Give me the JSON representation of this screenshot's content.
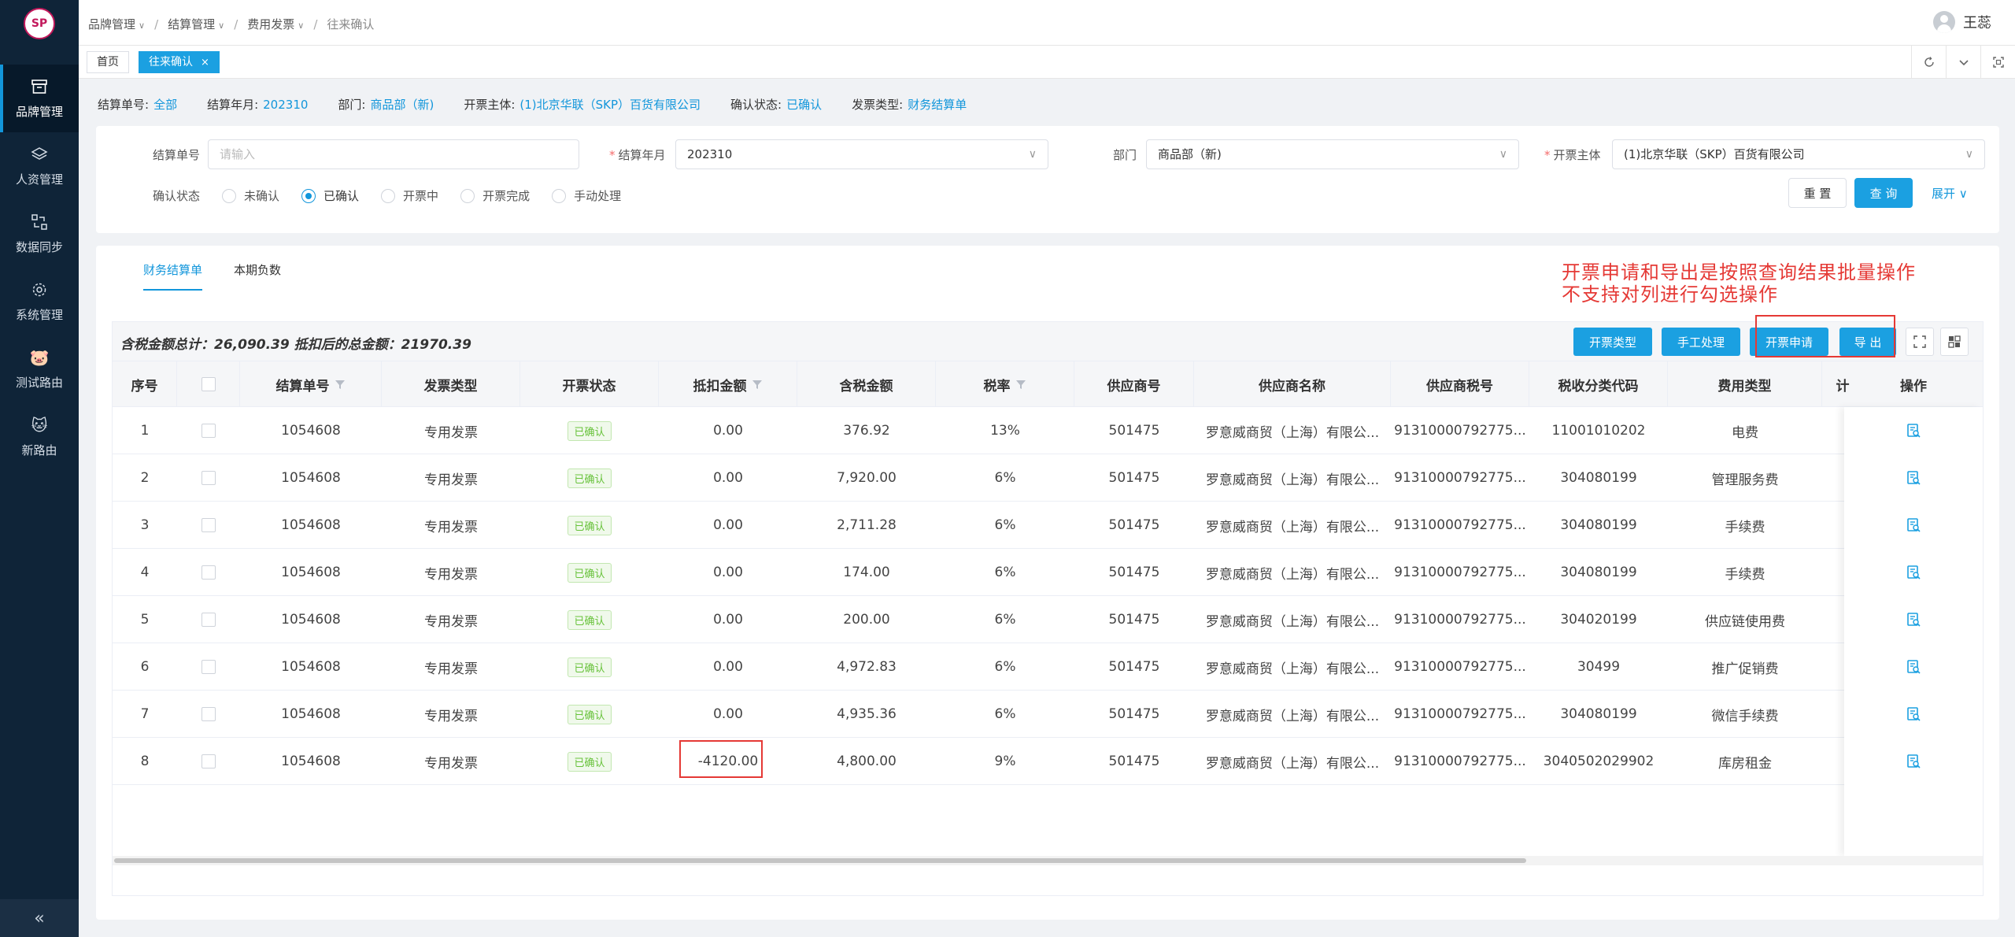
{
  "sidebar": {
    "logo_text": "SP",
    "items": [
      {
        "label": "品牌管理",
        "icon": "archive-box-icon",
        "active": true
      },
      {
        "label": "人资管理",
        "icon": "layers-icon",
        "active": false
      },
      {
        "label": "数据同步",
        "icon": "sync-icon",
        "active": false
      },
      {
        "label": "系统管理",
        "icon": "gear-icon",
        "active": false
      },
      {
        "label": "测试路由",
        "icon": "pig-face-icon",
        "active": false
      },
      {
        "label": "新路由",
        "icon": "cat-face-icon",
        "active": false
      }
    ],
    "collapse_symbol": "«"
  },
  "breadcrumb": {
    "items": [
      "品牌管理",
      "结算管理",
      "费用发票",
      "往来确认"
    ]
  },
  "user": {
    "name": "王蕊"
  },
  "tabs": [
    {
      "label": "首页",
      "active": false
    },
    {
      "label": "往来确认",
      "active": true,
      "close": "×"
    }
  ],
  "info": {
    "settle_no_label": "结算单号:",
    "settle_no_value": "全部",
    "settle_month_label": "结算年月:",
    "settle_month_value": "202310",
    "dept_label": "部门:",
    "dept_value": "商品部（新)",
    "entity_label": "开票主体:",
    "entity_value": "(1)北京华联（SKP）百货有限公司",
    "confirm_label": "确认状态:",
    "confirm_value": "已确认",
    "invoice_type_label": "发票类型:",
    "invoice_type_value": "财务结算单"
  },
  "filter": {
    "settle_no_label": "结算单号",
    "settle_no_placeholder": "请输入",
    "req_mark": "*",
    "settle_month_label": "结算年月",
    "settle_month_value": "202310",
    "dept_label": "部门",
    "dept_value": "商品部（新)",
    "entity_label": "开票主体",
    "entity_value": "(1)北京华联（SKP）百货有限公司",
    "status_label": "确认状态",
    "statuses": [
      {
        "label": "未确认",
        "checked": false
      },
      {
        "label": "已确认",
        "checked": true
      },
      {
        "label": "开票中",
        "checked": false
      },
      {
        "label": "开票完成",
        "checked": false
      },
      {
        "label": "手动处理",
        "checked": false
      }
    ],
    "reset_label": "重 置",
    "query_label": "查 询",
    "expand_label": "展开"
  },
  "subtabs": [
    {
      "label": "财务结算单",
      "active": true
    },
    {
      "label": "本期负数",
      "active": false
    }
  ],
  "annotation": {
    "line1": "开票申请和导出是按照查询结果批量操作",
    "line2": "不支持对列进行勾选操作"
  },
  "summary": {
    "text": "含税金额总计：26,090.39  抵扣后的总金额：21970.39"
  },
  "toolbar": {
    "invoice_type_btn": "开票类型",
    "manual_btn": "手工处理",
    "apply_btn": "开票申请",
    "export_btn": "导 出"
  },
  "table": {
    "columns": [
      "序号",
      "",
      "结算单号",
      "发票类型",
      "开票状态",
      "抵扣金额",
      "含税金额",
      "税率",
      "供应商号",
      "供应商名称",
      "供应商税号",
      "税收分类代码",
      "费用类型",
      "计",
      "操作"
    ],
    "rows": [
      [
        "1",
        "1054608",
        "专用发票",
        "已确认",
        "0.00",
        "376.92",
        "13%",
        "501475",
        "罗意威商贸（上海）有限公...",
        "91310000792775...",
        "11001010202",
        "电费"
      ],
      [
        "2",
        "1054608",
        "专用发票",
        "已确认",
        "0.00",
        "7,920.00",
        "6%",
        "501475",
        "罗意威商贸（上海）有限公...",
        "91310000792775...",
        "304080199",
        "管理服务费"
      ],
      [
        "3",
        "1054608",
        "专用发票",
        "已确认",
        "0.00",
        "2,711.28",
        "6%",
        "501475",
        "罗意威商贸（上海）有限公...",
        "91310000792775...",
        "304080199",
        "手续费"
      ],
      [
        "4",
        "1054608",
        "专用发票",
        "已确认",
        "0.00",
        "174.00",
        "6%",
        "501475",
        "罗意威商贸（上海）有限公...",
        "91310000792775...",
        "304080199",
        "手续费"
      ],
      [
        "5",
        "1054608",
        "专用发票",
        "已确认",
        "0.00",
        "200.00",
        "6%",
        "501475",
        "罗意威商贸（上海）有限公...",
        "91310000792775...",
        "304020199",
        "供应链使用费"
      ],
      [
        "6",
        "1054608",
        "专用发票",
        "已确认",
        "0.00",
        "4,972.83",
        "6%",
        "501475",
        "罗意威商贸（上海）有限公...",
        "91310000792775...",
        "30499",
        "推广促销费"
      ],
      [
        "7",
        "1054608",
        "专用发票",
        "已确认",
        "0.00",
        "4,935.36",
        "6%",
        "501475",
        "罗意威商贸（上海）有限公...",
        "91310000792775...",
        "304080199",
        "微信手续费"
      ],
      [
        "8",
        "1054608",
        "专用发票",
        "已确认",
        "-4120.00",
        "4,800.00",
        "9%",
        "501475",
        "罗意威商贸（上海）有限公...",
        "91310000792775...",
        "3040502029902",
        "库房租金"
      ]
    ]
  },
  "colors": {
    "primary": "#1ba0e1",
    "sidebar": "#0f2438",
    "annotation": "#e53935",
    "tag_green": "#67c23a"
  }
}
